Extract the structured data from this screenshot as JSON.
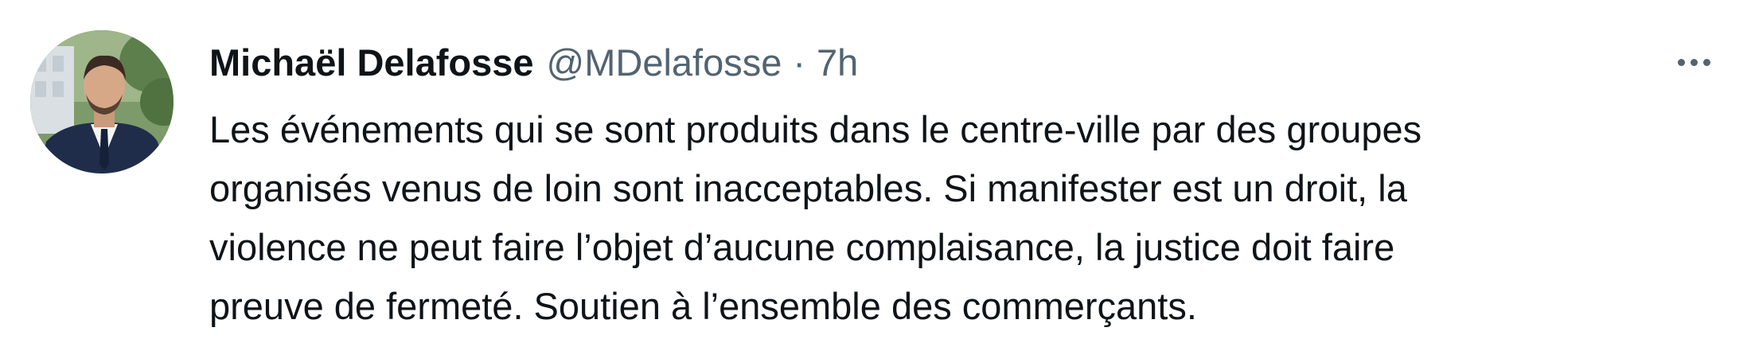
{
  "author": {
    "display_name": "Michaël Delafosse",
    "handle": "@MDelafosse",
    "separator": "·",
    "time": "7h"
  },
  "tweet": {
    "lines": [
      "Les événements qui se sont produits dans le centre-ville par des groupes",
      "organisés venus de loin sont inacceptables. Si manifester est un droit, la",
      "violence ne peut faire l’objet d’aucune complaisance, la justice doit faire",
      "preuve de fermeté. Soutien à l’ensemble des commerçants."
    ]
  },
  "icons": {
    "more": "more-horizontal-icon"
  },
  "colors": {
    "text_primary": "#0f1419",
    "text_secondary": "#536471",
    "background": "#ffffff"
  }
}
